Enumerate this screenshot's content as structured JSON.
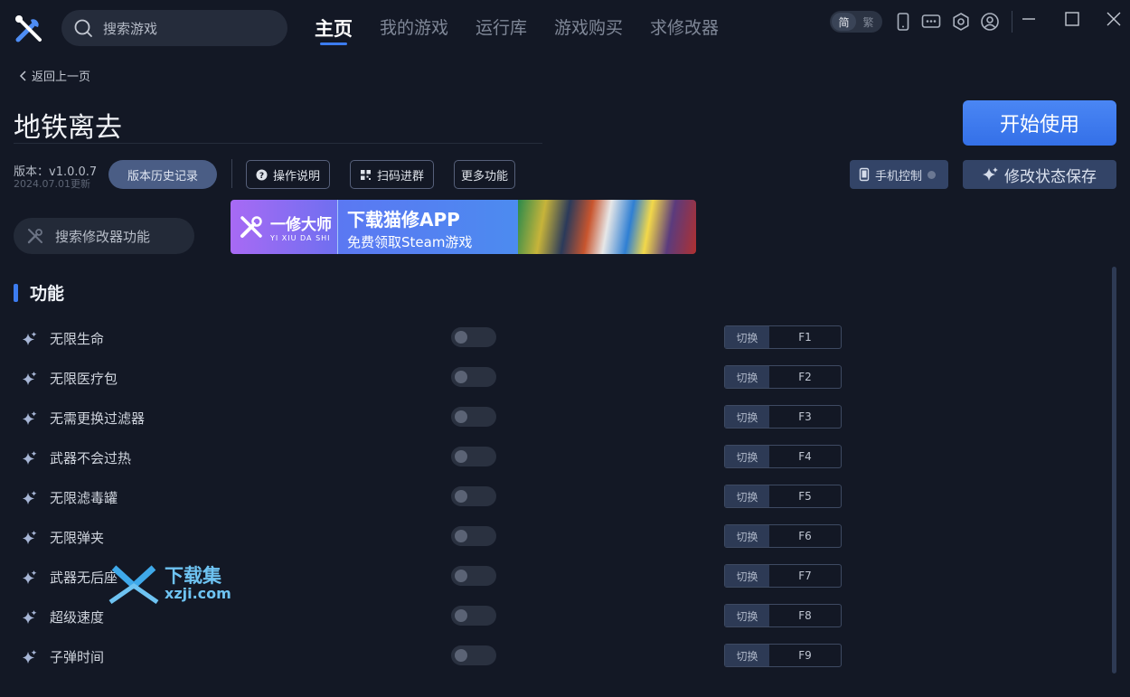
{
  "topbar": {
    "search_placeholder": "搜索游戏",
    "tabs": [
      {
        "label": "主页",
        "active": true
      },
      {
        "label": "我的游戏",
        "active": false
      },
      {
        "label": "运行库",
        "active": false
      },
      {
        "label": "游戏购买",
        "active": false
      },
      {
        "label": "求修改器",
        "active": false
      }
    ],
    "lang": {
      "simplified": "简",
      "traditional": "繁",
      "selected": "简"
    },
    "icons": [
      "phone-icon",
      "chat-icon",
      "settings-icon",
      "user-icon"
    ],
    "window": [
      "minimize-icon",
      "maximize-icon",
      "close-icon"
    ]
  },
  "back_label": "返回上一页",
  "game": {
    "title": "地铁离去",
    "version": "版本：v1.0.0.7",
    "updated": "2024.07.01更新",
    "start_label": "开始使用"
  },
  "actions": {
    "history": "版本历史记录",
    "manual": "操作说明",
    "scan": "扫码进群",
    "more": "更多功能",
    "phone": "手机控制",
    "save": "修改状态保存"
  },
  "mod_search_placeholder": "搜索修改器功能",
  "banner": {
    "brand_cn": "一修大师",
    "brand_py": "YI XIU DA SHI",
    "line1": "下载猫修APP",
    "line2": "免费领取Steam游戏"
  },
  "section_title": "功能",
  "functions": [
    {
      "name": "无限生命",
      "enabled": false,
      "switch": "切换",
      "key": "F1"
    },
    {
      "name": "无限医疗包",
      "enabled": false,
      "switch": "切换",
      "key": "F2"
    },
    {
      "name": "无需更换过滤器",
      "enabled": false,
      "switch": "切换",
      "key": "F3"
    },
    {
      "name": "武器不会过热",
      "enabled": false,
      "switch": "切换",
      "key": "F4"
    },
    {
      "name": "无限滤毒罐",
      "enabled": false,
      "switch": "切换",
      "key": "F5"
    },
    {
      "name": "无限弹夹",
      "enabled": false,
      "switch": "切换",
      "key": "F6"
    },
    {
      "name": "武器无后座",
      "enabled": false,
      "switch": "切换",
      "key": "F7"
    },
    {
      "name": "超级速度",
      "enabled": false,
      "switch": "切换",
      "key": "F8"
    },
    {
      "name": "子弹时间",
      "enabled": false,
      "switch": "切换",
      "key": "F9"
    }
  ],
  "watermark": {
    "cn": "下载集",
    "url": "xzji.com"
  },
  "colors": {
    "accent": "#3c7cf0",
    "background": "#131825",
    "start_button": "#4a86f4"
  }
}
